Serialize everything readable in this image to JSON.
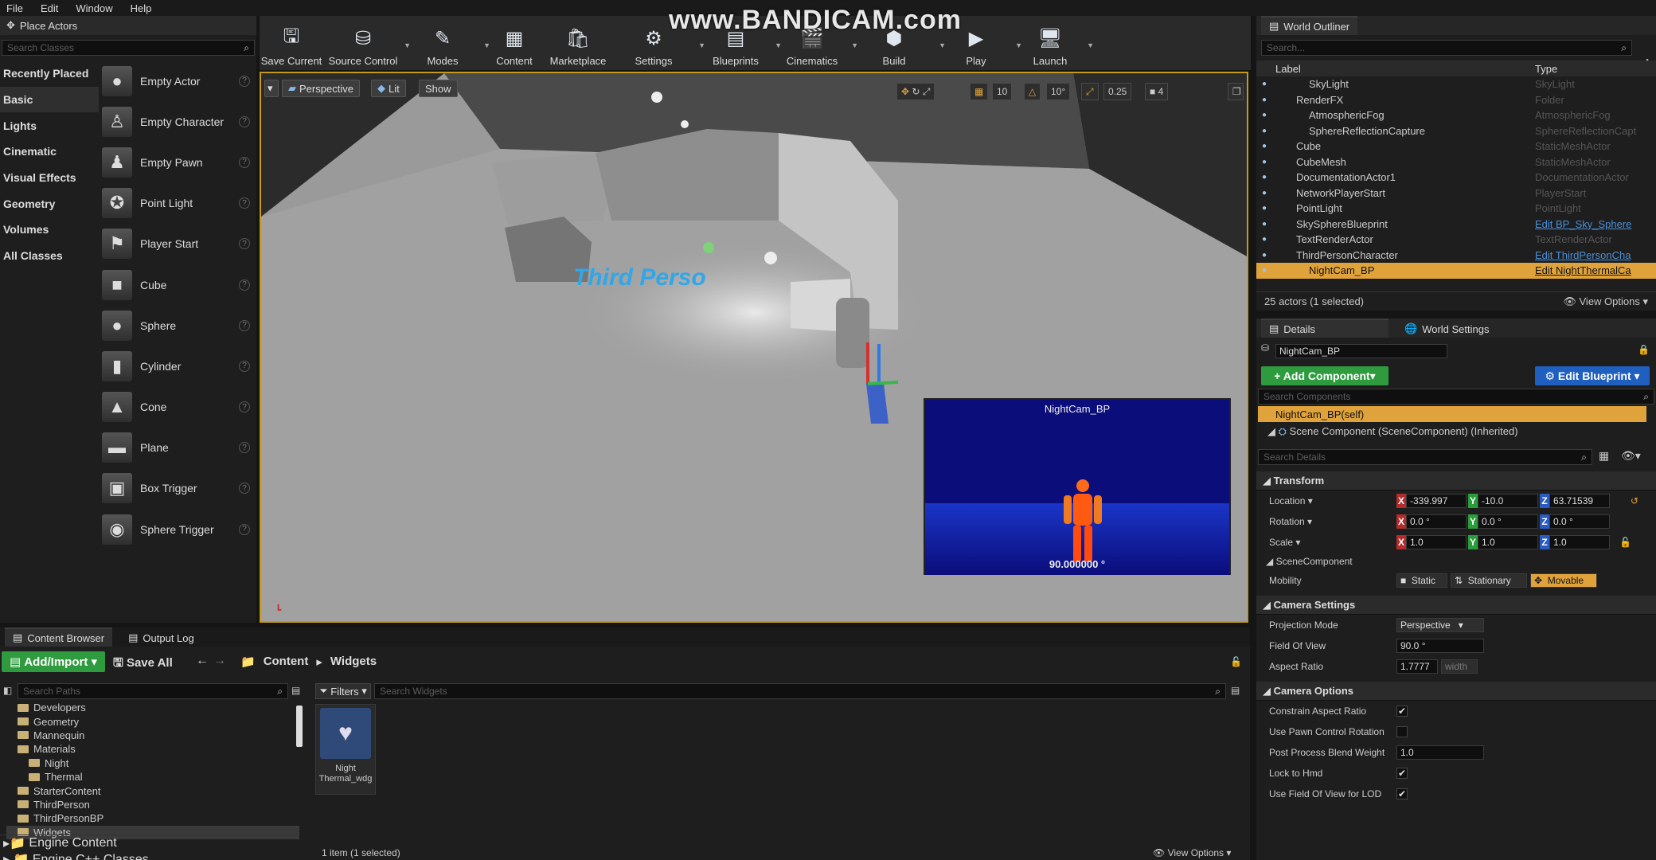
{
  "menu": [
    "File",
    "Edit",
    "Window",
    "Help"
  ],
  "watermark": "www.BANDICAM.com",
  "place_actors": {
    "title": "Place Actors",
    "search_placeholder": "Search Classes",
    "categories": [
      "Recently Placed",
      "Basic",
      "Lights",
      "Cinematic",
      "Visual Effects",
      "Geometry",
      "Volumes",
      "All Classes"
    ],
    "selected_category": "Basic",
    "actors": [
      {
        "label": "Empty Actor",
        "icon": "sphere-icon"
      },
      {
        "label": "Empty Character",
        "icon": "character-icon"
      },
      {
        "label": "Empty Pawn",
        "icon": "pawn-icon"
      },
      {
        "label": "Point Light",
        "icon": "light-bulb-icon"
      },
      {
        "label": "Player Start",
        "icon": "flag-icon"
      },
      {
        "label": "Cube",
        "icon": "cube-icon"
      },
      {
        "label": "Sphere",
        "icon": "sphere-icon"
      },
      {
        "label": "Cylinder",
        "icon": "cylinder-icon"
      },
      {
        "label": "Cone",
        "icon": "cone-icon"
      },
      {
        "label": "Plane",
        "icon": "plane-icon"
      },
      {
        "label": "Box Trigger",
        "icon": "box-trigger-icon"
      },
      {
        "label": "Sphere Trigger",
        "icon": "sphere-trigger-icon"
      }
    ]
  },
  "toolbar": {
    "buttons": [
      {
        "label": "Save Current",
        "icon": "save-icon"
      },
      {
        "label": "Source Control",
        "icon": "source-control-icon"
      },
      {
        "label": "Modes",
        "icon": "modes-icon"
      },
      {
        "label": "Content",
        "icon": "content-icon"
      },
      {
        "label": "Marketplace",
        "icon": "marketplace-icon"
      },
      {
        "label": "Settings",
        "icon": "settings-icon"
      },
      {
        "label": "Blueprints",
        "icon": "blueprints-icon"
      },
      {
        "label": "Cinematics",
        "icon": "cinematics-icon"
      },
      {
        "label": "Build",
        "icon": "build-icon"
      },
      {
        "label": "Play",
        "icon": "play-icon"
      },
      {
        "label": "Launch",
        "icon": "launch-icon"
      }
    ]
  },
  "viewport": {
    "perspective": "Perspective",
    "lit": "Lit",
    "show": "Show",
    "snap_values": [
      "10",
      "10°",
      "0.25",
      "4"
    ],
    "scene_text": "Third Perso",
    "pip_title": "NightCam_BP",
    "pip_fov": "90.000000 °"
  },
  "outliner": {
    "title": "World Outliner",
    "search_placeholder": "Search...",
    "col_label": "Label",
    "col_type": "Type",
    "rows": [
      {
        "label": "SkyLight",
        "type": "SkyLight",
        "indent": 2,
        "link": false,
        "selected": false
      },
      {
        "label": "RenderFX",
        "type": "Folder",
        "indent": 1,
        "link": false,
        "selected": false
      },
      {
        "label": "AtmosphericFog",
        "type": "AtmosphericFog",
        "indent": 2,
        "link": false,
        "selected": false
      },
      {
        "label": "SphereReflectionCapture",
        "type": "SphereReflectionCapt",
        "indent": 2,
        "link": false,
        "selected": false
      },
      {
        "label": "Cube",
        "type": "StaticMeshActor",
        "indent": 1,
        "link": false,
        "selected": false
      },
      {
        "label": "CubeMesh",
        "type": "StaticMeshActor",
        "indent": 1,
        "link": false,
        "selected": false
      },
      {
        "label": "DocumentationActor1",
        "type": "DocumentationActor",
        "indent": 1,
        "link": false,
        "selected": false
      },
      {
        "label": "NetworkPlayerStart",
        "type": "PlayerStart",
        "indent": 1,
        "link": false,
        "selected": false
      },
      {
        "label": "PointLight",
        "type": "PointLight",
        "indent": 1,
        "link": false,
        "selected": false
      },
      {
        "label": "SkySphereBlueprint",
        "type": "Edit BP_Sky_Sphere",
        "indent": 1,
        "link": true,
        "selected": false
      },
      {
        "label": "TextRenderActor",
        "type": "TextRenderActor",
        "indent": 1,
        "link": false,
        "selected": false
      },
      {
        "label": "ThirdPersonCharacter",
        "type": "Edit ThirdPersonCha",
        "indent": 1,
        "link": true,
        "selected": false
      },
      {
        "label": "NightCam_BP",
        "type": "Edit NightThermalCa",
        "indent": 2,
        "link": true,
        "selected": true
      }
    ],
    "footer": "25 actors (1 selected)",
    "view_options": "View Options"
  },
  "details": {
    "tab_details": "Details",
    "tab_world": "World Settings",
    "name_value": "NightCam_BP",
    "add_component": "+ Add Component",
    "edit_blueprint": "Edit Blueprint",
    "search_components": "Search Components",
    "self_component": "NightCam_BP(self)",
    "scene_component": "Scene Component (SceneComponent) (Inherited)",
    "search_details": "Search Details",
    "transform_header": "Transform",
    "location": {
      "label": "Location",
      "x": "-339.997",
      "y": "-10.0",
      "z": "63.71539"
    },
    "rotation": {
      "label": "Rotation",
      "x": "0.0 °",
      "y": "0.0 °",
      "z": "0.0 °"
    },
    "scale": {
      "label": "Scale",
      "x": "1.0",
      "y": "1.0",
      "z": "1.0"
    },
    "scene_component_label": "SceneComponent",
    "mobility_label": "Mobility",
    "mobility_options": [
      "Static",
      "Stationary",
      "Movable"
    ],
    "mobility_selected": "Movable",
    "camera_settings_header": "Camera Settings",
    "projection_mode_label": "Projection Mode",
    "projection_mode_value": "Perspective",
    "fov_label": "Field Of View",
    "fov_value": "90.0 °",
    "aspect_label": "Aspect Ratio",
    "aspect_value": "1.7777",
    "aspect_unit": "width",
    "camera_options_header": "Camera Options",
    "options": [
      {
        "label": "Constrain Aspect Ratio",
        "checked": true
      },
      {
        "label": "Use Pawn Control Rotation",
        "checked": false
      },
      {
        "label": "Post Process Blend Weight",
        "value": "1.0"
      },
      {
        "label": "Lock to Hmd",
        "checked": true
      },
      {
        "label": "Use Field Of View for LOD",
        "checked": true
      }
    ]
  },
  "content_browser": {
    "tab_content": "Content Browser",
    "tab_output": "Output Log",
    "add_import": "Add/Import",
    "save_all": "Save All",
    "breadcrumb": [
      "Content",
      "Widgets"
    ],
    "search_paths": "Search Paths",
    "filters": "Filters",
    "search_widgets": "Search Widgets",
    "tree": [
      {
        "label": "Developers",
        "indent": 1
      },
      {
        "label": "Geometry",
        "indent": 1
      },
      {
        "label": "Mannequin",
        "indent": 1
      },
      {
        "label": "Materials",
        "indent": 1
      },
      {
        "label": "Night",
        "indent": 2
      },
      {
        "label": "Thermal",
        "indent": 2
      },
      {
        "label": "StarterContent",
        "indent": 1
      },
      {
        "label": "ThirdPerson",
        "indent": 1
      },
      {
        "label": "ThirdPersonBP",
        "indent": 1
      },
      {
        "label": "Widgets",
        "indent": 1
      }
    ],
    "engine_content": "Engine Content",
    "engine_classes": "Engine C++ Classes",
    "asset_name": "Night Thermal_wdg",
    "status": "1 item (1 selected)",
    "view_options": "View Options"
  }
}
